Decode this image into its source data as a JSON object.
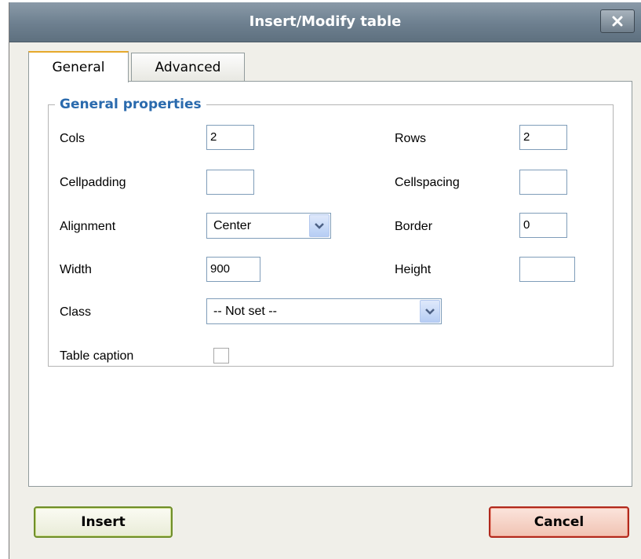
{
  "dialog": {
    "title": "Insert/Modify table",
    "close_icon": "close-icon"
  },
  "tabs": [
    {
      "label": "General",
      "active": true
    },
    {
      "label": "Advanced",
      "active": false
    }
  ],
  "general": {
    "legend": "General properties",
    "cols": {
      "label": "Cols",
      "value": "2"
    },
    "rows": {
      "label": "Rows",
      "value": "2"
    },
    "cellpadding": {
      "label": "Cellpadding",
      "value": ""
    },
    "cellspacing": {
      "label": "Cellspacing",
      "value": ""
    },
    "alignment": {
      "label": "Alignment",
      "value": "Center"
    },
    "border": {
      "label": "Border",
      "value": "0"
    },
    "width": {
      "label": "Width",
      "value": "900"
    },
    "height": {
      "label": "Height",
      "value": ""
    },
    "class": {
      "label": "Class",
      "value": "-- Not set --"
    },
    "caption": {
      "label": "Table caption",
      "checked": false
    }
  },
  "buttons": {
    "insert": "Insert",
    "cancel": "Cancel"
  },
  "colors": {
    "legend": "#2a6aad",
    "insert_border": "#6f8e2a",
    "cancel_border": "#b0291d"
  }
}
